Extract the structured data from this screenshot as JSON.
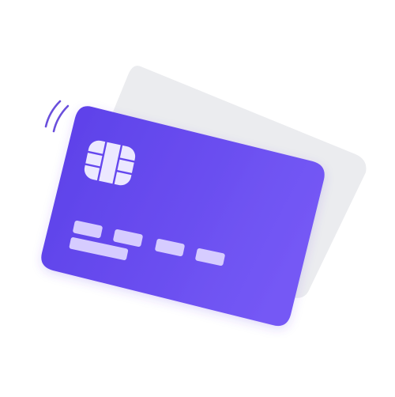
{
  "illustration": {
    "subject": "credit-card-contactless",
    "colors": {
      "background": "#ffffff",
      "back_card": "#ebecef",
      "front_card_start": "#5b3fe8",
      "front_card_end": "#7458f5",
      "chip": "#ece8ff",
      "chip_lines": "#6547ee",
      "number_blocks": "#d6ccff",
      "contactless_waves": "#6a4fdc"
    },
    "icons": {
      "chip": "emv-chip-icon",
      "contactless": "contactless-waves-icon"
    },
    "card_number_groups": 4
  }
}
